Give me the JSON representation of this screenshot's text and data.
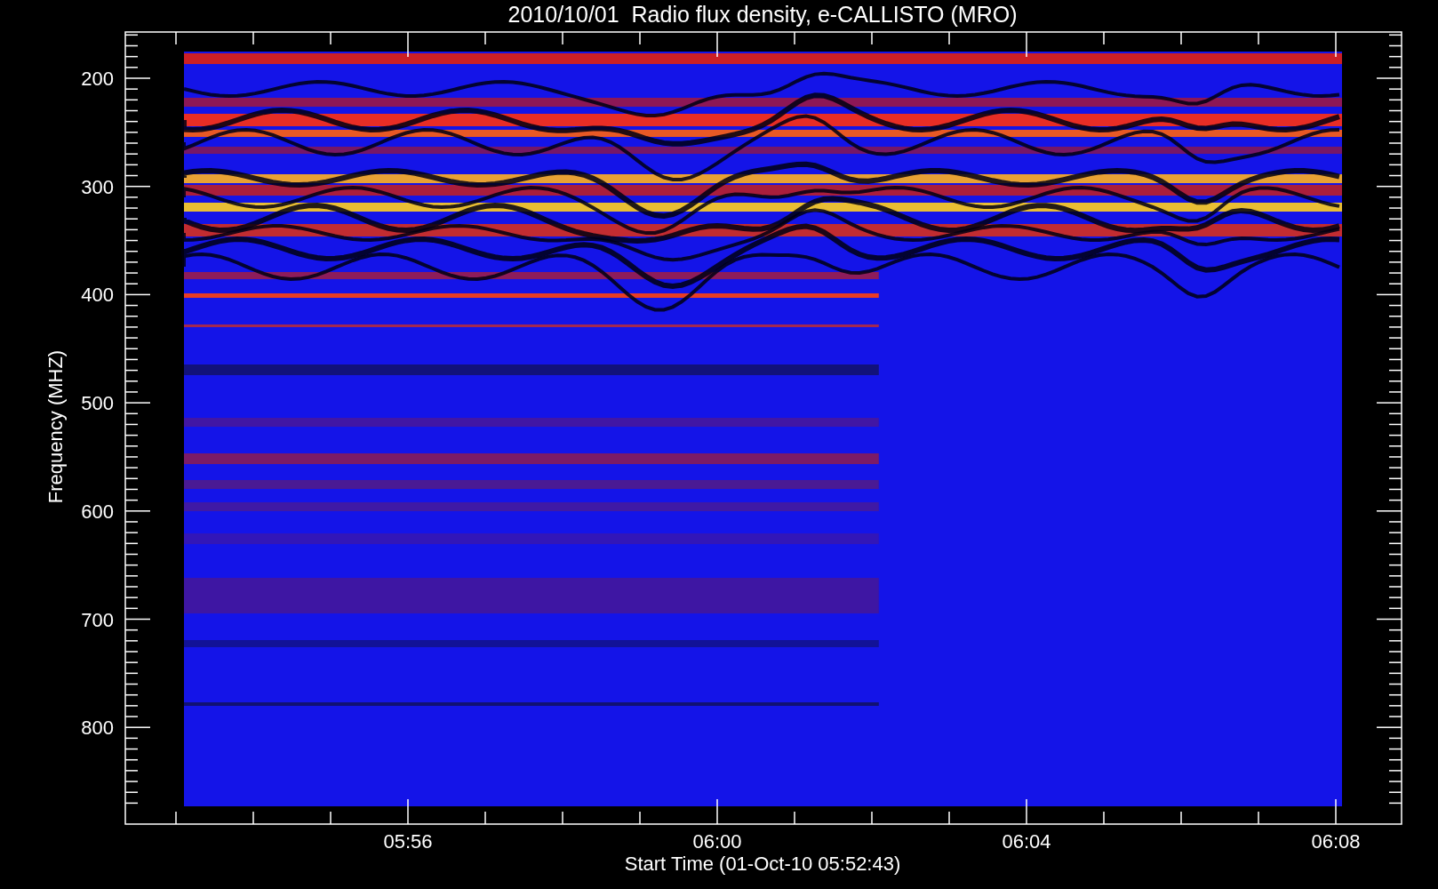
{
  "title": "2010/10/01  Radio flux density, e-CALLISTO (MRO)",
  "y_axis": {
    "label": "Frequency (MHZ)",
    "ticks": [
      "200",
      "300",
      "400",
      "500",
      "600",
      "700",
      "800"
    ]
  },
  "x_axis": {
    "label": "Start Time (01-Oct-10 05:52:43)",
    "ticks": [
      "05:56",
      "06:00",
      "06:04",
      "06:08"
    ]
  }
}
